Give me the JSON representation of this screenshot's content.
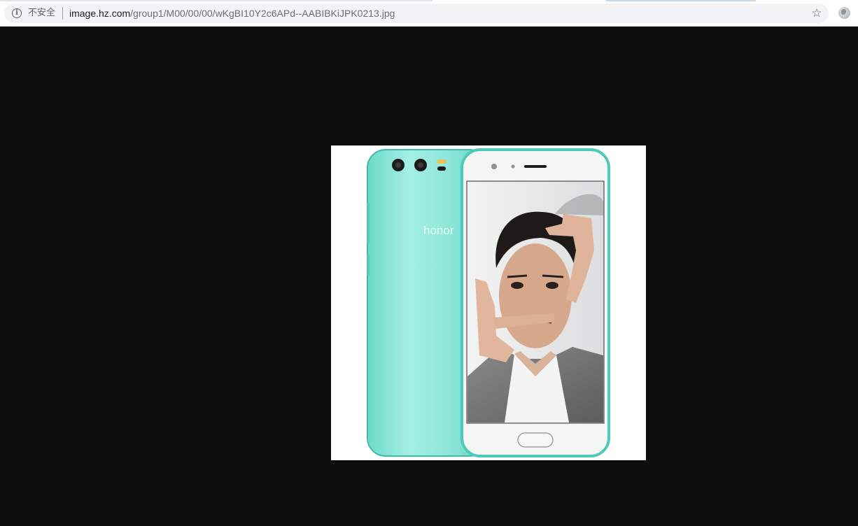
{
  "address_bar": {
    "security_label": "不安全",
    "url_host": "image.hz.com",
    "url_path": "/group1/M00/00/00/wKgBI10Y2c6APd--AABIBKiJPK0213.jpg"
  },
  "image": {
    "brand_text": "honor",
    "colors": {
      "phone_body": "#8ee6d8",
      "phone_body_light": "#b8f3ea",
      "frame_edge": "#4fc9b8",
      "front_face": "#f4f6f5"
    }
  },
  "icons": {
    "info": "info-icon",
    "bookmark": "star-icon",
    "profile": "globe-icon"
  }
}
